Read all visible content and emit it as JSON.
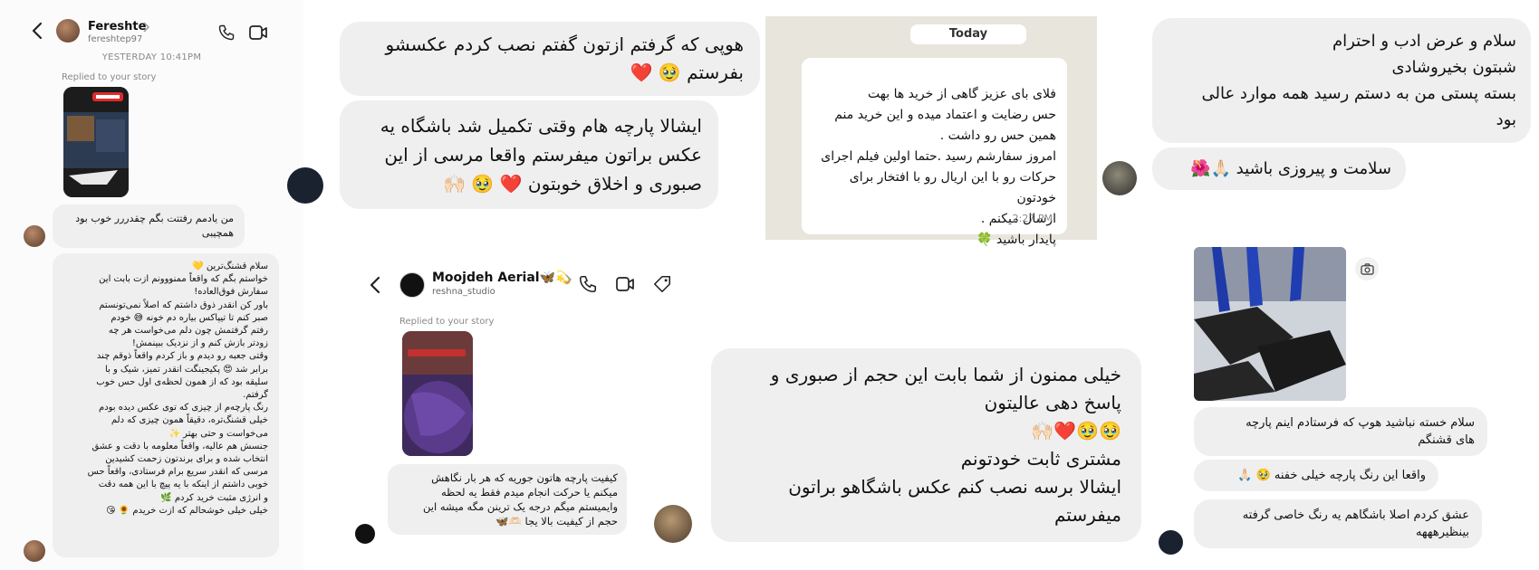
{
  "panel1": {
    "contact_name": "Fereshte",
    "contact_username": "fereshtep97",
    "date_divider": "YESTERDAY 10:41PM",
    "replied_label": "Replied to your story",
    "message1": "من یادمم رفتتت بگم چقدررر خوب بود\nهمچیبی",
    "message2": "سلام قشنگ‌ترین 💛\nخواستم بگم که واقعاً ممنووونم ازت بابت این\nسفارش فوق‌العاده!\nباور کن انقدر ذوق داشتم که اصلاً نمی‌تونستم\nصبر کنم تا تیپاکس بیاره دم خونه 😅 خودم\nرفتم گرفتمش چون دلم می‌خواست هر چه\nزودتر بازش کنم و از نزدیک ببینمش!\nوقتی جعبه رو دیدم و باز کردم واقعاً ذوقم چند\nبرابر شد 😍 پکیجینگت انقدر تمیز، شیک و با\nسلیقه بود که از همون لحظه‌ی اول حس خوب\nگرفتم.\nرنگ پارچه‌م از چیزی که توی عکس دیده بودم\nخیلی قشنگ‌تره، دقیقاً همون چیزی که دلم\nمی‌خواست و حتی بهتر ✨\nجنسش هم عالیه، واقعاً معلومه با دقت و عشق\nانتخاب شده و برای برندتون زحمت کشیدین\nمرسی که انقدر سریع برام فرستادی، واقعاً حس\nخوبی داشتم از اینکه با یه پیچ با این همه دقت\nو انرژی مثبت خرید کردم 🌿\nخیلی خیلی خوشحالم که ازت خریدم 🌻 😘"
  },
  "panel2": {
    "message1": "هوپی که گرفتم ازتون گفتم نصب کردم عکسشو\nبفرستم 🥹 ❤️",
    "message2": "ایشالا پارچه هام وقتی تکمیل شد باشگاه یه\nعکس براتون میفرستم واقعا مرسی از این\nصبوری و اخلاق خوبتون ❤️ 🥹 🙌🏻"
  },
  "panel3": {
    "date_chip": "Today",
    "message": "فلای بای عزیز گاهی از خرید ها بهت\nحس رضایت و اعتماد میده و این خرید منم\nهمین حس  رو داشت .\nامروز سفارشم رسید .حتما اولین فیلم اجرای\nحرکات رو با این اریال رو با افتخار برای خودتون\nارسال میکنم .\nپایدار باشید 🍀",
    "time": "2:27 PM"
  },
  "panel4": {
    "message1": "سلام و عرض ادب و احترام\nشبتون بخیروشادی\nبسته پستی من به دستم رسید همه موارد عالی\nبود",
    "message2": "سلامت و پیروزی باشید 🙏🏻🌺"
  },
  "panel5": {
    "contact_name": "Moojdeh Aerial🦋💫",
    "contact_username": "reshna_studio",
    "replied_label": "Replied to your story",
    "message": "کیفیت پارچه هاتون جوریه که هر بار نگاهش\nمیکنم یا حرکت انجام میدم فقط یه لحظه\nوایمیستم میگم درجه یک ترینن مگه میشه این\nحجم از کیفیت بالا یجا 🫶🏻🦋"
  },
  "panel6": {
    "message": "خیلی ممنون از شما بابت این حجم از  صبوری و\nپاسخ دهی عالیتون\n🙌🏻❤️🥹🥹\nمشتری ثابت خودتونم\nایشالا برسه نصب کنم  عکس باشگاهو براتون\nمیفرستم"
  },
  "panel7": {
    "message1": "سلام خسته نباشید هوپ که فرستادم اینم پارچه\nهای قشنگم",
    "message2": "واقعا این رنگ پارچه خیلی خفنه 🥹 🙏🏻",
    "message3": "عشق کردم اصلا باشگاهم یه رنگ خاصی گرفته\nبینظیرهههه"
  },
  "colors": {
    "bubble": "#efefef",
    "whatsapp_bg": "#e8e5dd",
    "heart": "#e0242e"
  },
  "icons": [
    "back-arrow-icon",
    "phone-icon",
    "video-icon",
    "tag-icon",
    "camera-icon",
    "chevron-right-icon"
  ]
}
